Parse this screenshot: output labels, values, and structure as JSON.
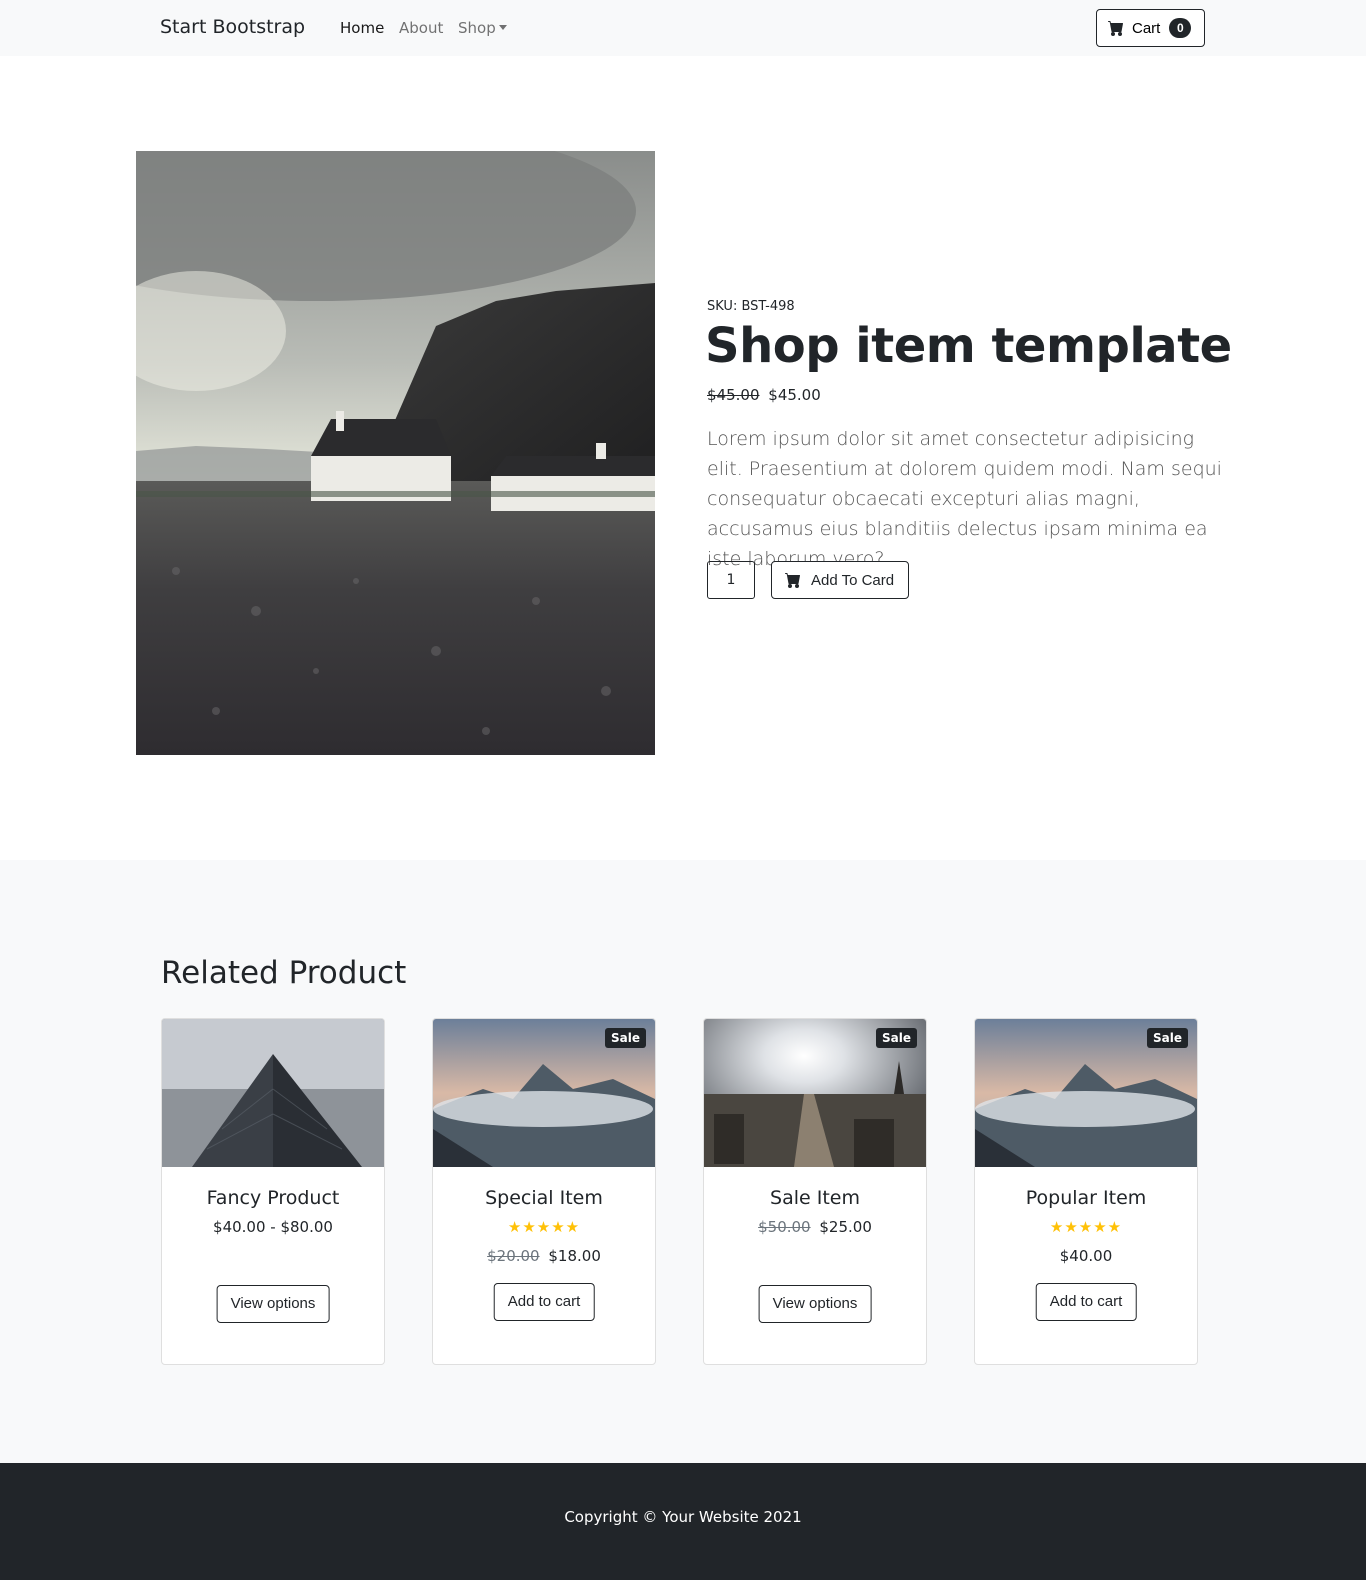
{
  "nav": {
    "brand": "Start Bootstrap",
    "links": [
      "Home",
      "About",
      "Shop"
    ],
    "cart_label": "Cart",
    "cart_count": "0"
  },
  "product": {
    "sku": "SKU: BST-498",
    "title": "Shop item template",
    "old_price": "$45.00",
    "price": "$45.00",
    "description": "Lorem ipsum dolor sit amet consectetur adipisicing elit. Praesentium at dolorem quidem modi. Nam sequi consequatur obcaecati excepturi alias magni, accusamus eius blanditiis delectus ipsam minima ea iste laborum vero?",
    "quantity": "1",
    "add_button": "Add To Card"
  },
  "related": {
    "title": "Related Product",
    "cards": [
      {
        "name": "Fancy Product",
        "badge": "",
        "stars": "",
        "old_price": "",
        "price": "$40.00 - $80.00",
        "button": "View options"
      },
      {
        "name": "Special Item",
        "badge": "Sale",
        "stars": "★★★★★",
        "old_price": "$20.00",
        "price": "$18.00",
        "button": "Add to cart"
      },
      {
        "name": "Sale Item",
        "badge": "Sale",
        "stars": "",
        "old_price": "$50.00",
        "price": "$25.00",
        "button": "View options"
      },
      {
        "name": "Popular Item",
        "badge": "Sale",
        "stars": "★★★★★",
        "old_price": "",
        "price": "$40.00",
        "button": "Add to cart"
      }
    ]
  },
  "footer": {
    "copyright": "Copyright © Your Website 2021"
  }
}
